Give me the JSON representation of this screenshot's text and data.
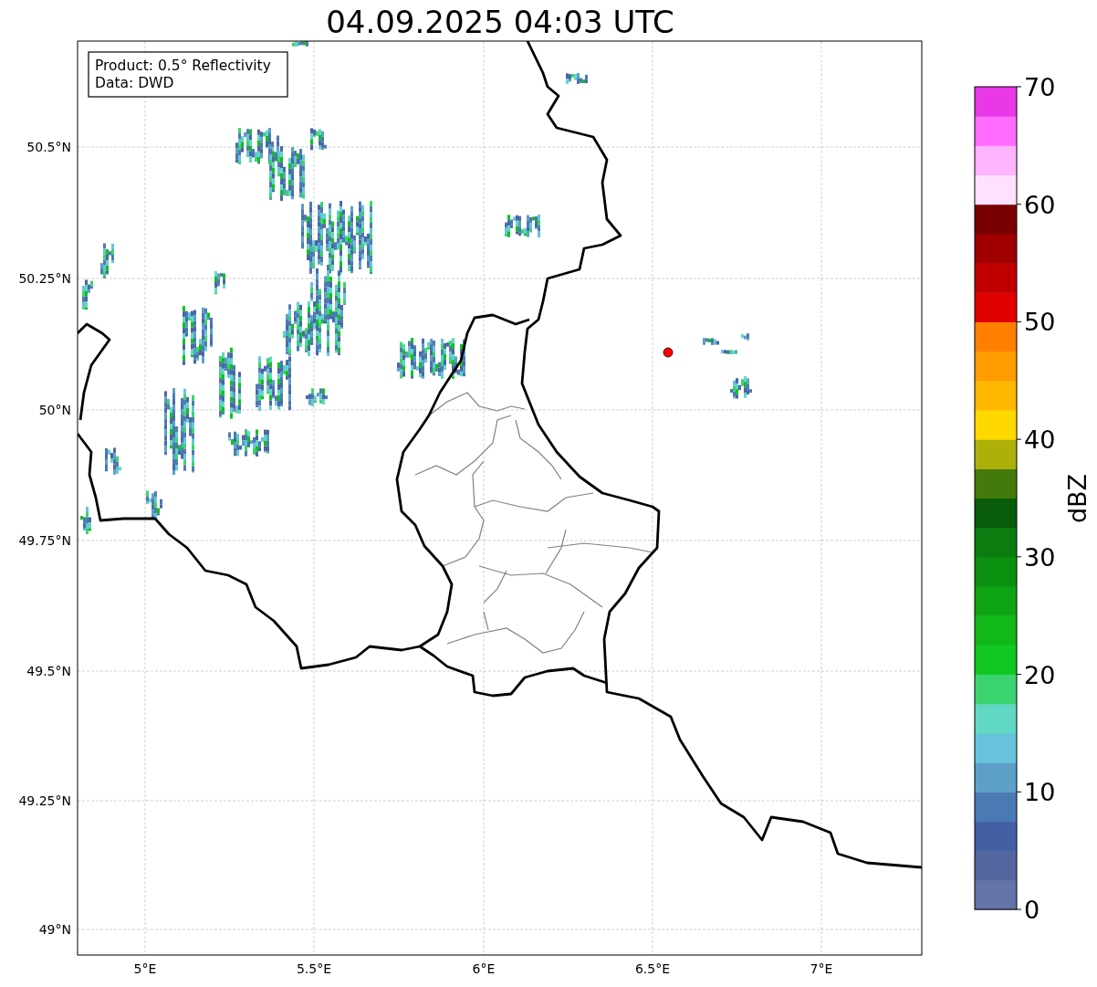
{
  "title": "04.09.2025 04:03 UTC",
  "info_box": [
    "Product: 0.5° Reflectivity",
    "Data: DWD"
  ],
  "map": {
    "x_ticks": [
      "5°E",
      "5.5°E",
      "6°E",
      "6.5°E",
      "7°E"
    ],
    "y_ticks": [
      "50.5°N",
      "50.25°N",
      "50°N",
      "49.75°N",
      "49.5°N",
      "49.25°N",
      "49°N"
    ]
  },
  "colorbar": {
    "label": "dBZ",
    "ticks": [
      "70",
      "60",
      "50",
      "40",
      "30",
      "20",
      "10",
      "0"
    ],
    "bands": [
      {
        "color": "#6474a8"
      },
      {
        "color": "#5466a0"
      },
      {
        "color": "#4460a4"
      },
      {
        "color": "#4a7ab4"
      },
      {
        "color": "#5ca0c8"
      },
      {
        "color": "#68c4dc"
      },
      {
        "color": "#60d8c4"
      },
      {
        "color": "#3cd470"
      },
      {
        "color": "#10c820"
      },
      {
        "color": "#10b818"
      },
      {
        "color": "#0ea414"
      },
      {
        "color": "#0c9010"
      },
      {
        "color": "#0a7c10"
      },
      {
        "color": "#085c0a"
      },
      {
        "color": "#447a0c"
      },
      {
        "color": "#acb008"
      },
      {
        "color": "#ffd800"
      },
      {
        "color": "#ffb800"
      },
      {
        "color": "#ff9c00"
      },
      {
        "color": "#ff8000"
      },
      {
        "color": "#e00000"
      },
      {
        "color": "#c00000"
      },
      {
        "color": "#a00000"
      },
      {
        "color": "#780000"
      },
      {
        "color": "#ffe0ff"
      },
      {
        "color": "#ffb4ff"
      },
      {
        "color": "#ff6cff"
      },
      {
        "color": "#e838e8"
      }
    ]
  }
}
